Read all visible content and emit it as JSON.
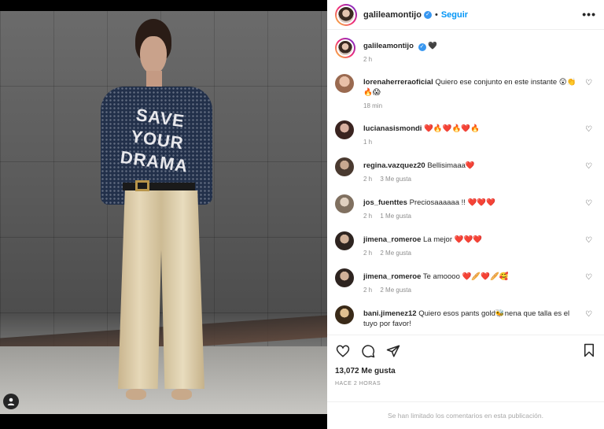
{
  "post": {
    "photo_alt_text": "",
    "sweater_text": "SAVE YOUR DRAMA"
  },
  "header": {
    "username": "galileamontijo",
    "separator": "•",
    "follow_label": "Seguir",
    "more_label": "•••"
  },
  "caption": {
    "username": "galileamontijo",
    "text": "🖤",
    "time": "2 h"
  },
  "comments": [
    {
      "username": "lorenaherreraoficial",
      "text": "Quiero ese conjunto en este instante 😲👏🔥😱",
      "time": "18 min",
      "likes": ""
    },
    {
      "username": "lucianasismondi",
      "text": "❤️🔥❤️🔥❤️🔥",
      "time": "1 h",
      "likes": ""
    },
    {
      "username": "regina.vazquez20",
      "text": "Bellisimaaa❤️",
      "time": "2 h",
      "likes": "3 Me gusta"
    },
    {
      "username": "jos_fuenttes",
      "text": "Preciosaaaaaa !! ❤️❤️❤️",
      "time": "2 h",
      "likes": "1 Me gusta"
    },
    {
      "username": "jimena_romeroe",
      "text": "La mejor ❤️❤️❤️",
      "time": "2 h",
      "likes": "2 Me gusta"
    },
    {
      "username": "jimena_romeroe",
      "text": "Te amoooo ❤️🥖❤️🥖🥰",
      "time": "2 h",
      "likes": "2 Me gusta"
    },
    {
      "username": "bani.jimenez12",
      "text": "Quiero esos pants gold🐝nena que talla es el tuyo por favor!",
      "time": "",
      "likes": ""
    }
  ],
  "stats": {
    "likes": "13,072 Me gusta",
    "ago": "HACE 2 HORAS"
  },
  "footer": {
    "limited_text": "Se han limitado los comentarios en esta publicación."
  },
  "colors": {
    "accent": "#0095f6",
    "verified": "#3897f0",
    "muted": "#8e8e8e"
  }
}
